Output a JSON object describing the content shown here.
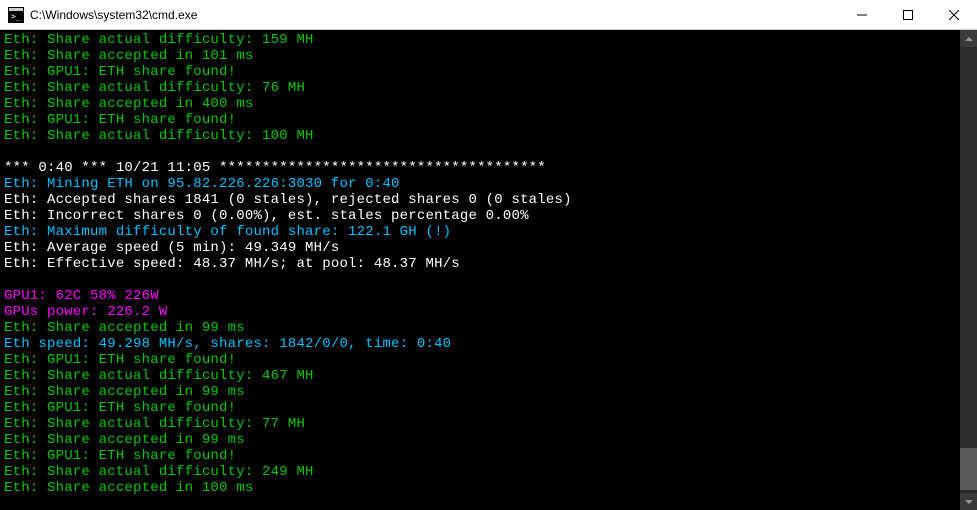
{
  "titlebar": {
    "title": "C:\\Windows\\system32\\cmd.exe"
  },
  "lines": [
    {
      "cls": "green",
      "text": "Eth: Share actual difficulty: 159 MH"
    },
    {
      "cls": "green",
      "text": "Eth: Share accepted in 101 ms"
    },
    {
      "cls": "green",
      "text": "Eth: GPU1: ETH share found!"
    },
    {
      "cls": "green",
      "text": "Eth: Share actual difficulty: 76 MH"
    },
    {
      "cls": "green",
      "text": "Eth: Share accepted in 400 ms"
    },
    {
      "cls": "green",
      "text": "Eth: GPU1: ETH share found!"
    },
    {
      "cls": "green",
      "text": "Eth: Share actual difficulty: 100 MH"
    },
    {
      "cls": "blank",
      "text": ""
    },
    {
      "cls": "white",
      "text": "*** 0:40 *** 10/21 11:05 **************************************"
    },
    {
      "cls": "cyan",
      "text": "Eth: Mining ETH on 95.82.226.226:3030 for 0:40"
    },
    {
      "cls": "white",
      "text": "Eth: Accepted shares 1841 (0 stales), rejected shares 0 (0 stales)"
    },
    {
      "cls": "white",
      "text": "Eth: Incorrect shares 0 (0.00%), est. stales percentage 0.00%"
    },
    {
      "cls": "cyan",
      "text": "Eth: Maximum difficulty of found share: 122.1 GH (!)"
    },
    {
      "cls": "white",
      "text": "Eth: Average speed (5 min): 49.349 MH/s"
    },
    {
      "cls": "white",
      "text": "Eth: Effective speed: 48.37 MH/s; at pool: 48.37 MH/s"
    },
    {
      "cls": "blank",
      "text": ""
    },
    {
      "cls": "magenta",
      "text": "GPU1: 62C 58% 226W"
    },
    {
      "cls": "magenta",
      "text": "GPUs power: 226.2 W"
    },
    {
      "cls": "green",
      "text": "Eth: Share accepted in 99 ms"
    },
    {
      "cls": "cyan",
      "text": "Eth speed: 49.298 MH/s, shares: 1842/0/0, time: 0:40"
    },
    {
      "cls": "green",
      "text": "Eth: GPU1: ETH share found!"
    },
    {
      "cls": "green",
      "text": "Eth: Share actual difficulty: 467 MH"
    },
    {
      "cls": "green",
      "text": "Eth: Share accepted in 99 ms"
    },
    {
      "cls": "green",
      "text": "Eth: GPU1: ETH share found!"
    },
    {
      "cls": "green",
      "text": "Eth: Share actual difficulty: 77 MH"
    },
    {
      "cls": "green",
      "text": "Eth: Share accepted in 99 ms"
    },
    {
      "cls": "green",
      "text": "Eth: GPU1: ETH share found!"
    },
    {
      "cls": "green",
      "text": "Eth: Share actual difficulty: 249 MH"
    },
    {
      "cls": "green",
      "text": "Eth: Share accepted in 100 ms"
    }
  ]
}
